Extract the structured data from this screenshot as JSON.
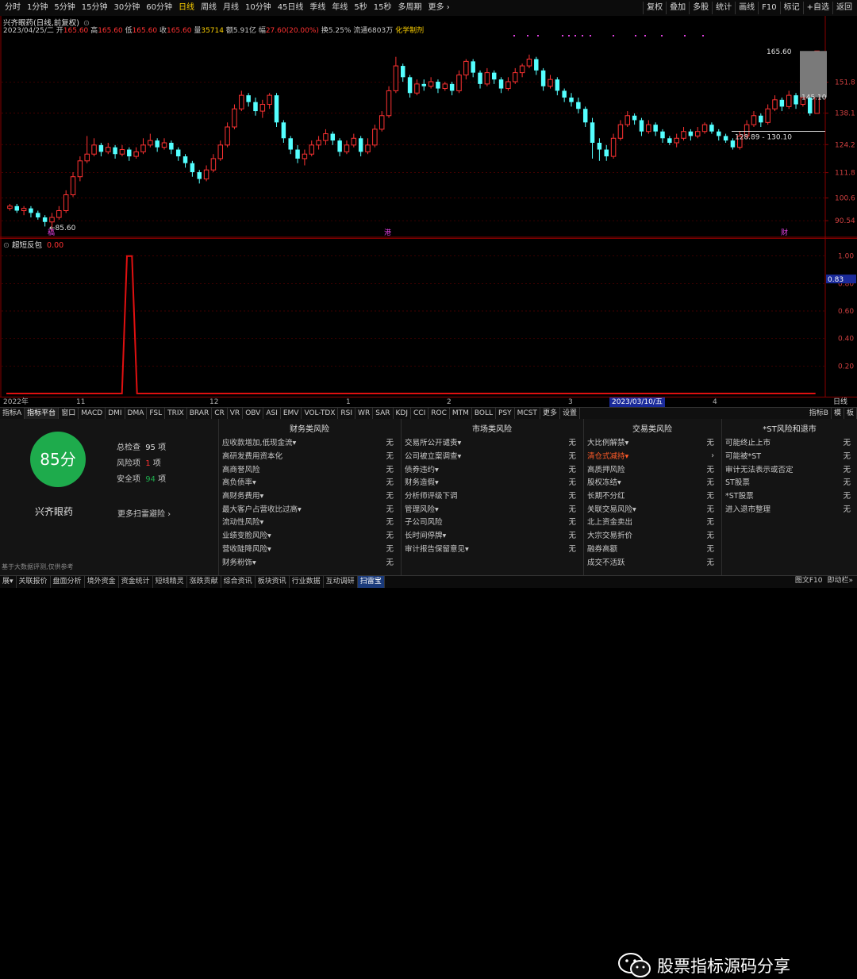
{
  "topbar": {
    "periods": [
      "分时",
      "1分钟",
      "5分钟",
      "15分钟",
      "30分钟",
      "60分钟",
      "日线",
      "周线",
      "月线",
      "10分钟",
      "45日线",
      "季线",
      "年线",
      "5秒",
      "15秒",
      "多周期",
      "更多 ›"
    ],
    "active_period": "日线",
    "right_buttons": [
      "复权",
      "叠加",
      "多股",
      "统计",
      "画线",
      "F10",
      "标记",
      "+自选",
      "返回"
    ]
  },
  "header": {
    "title": "兴齐眼药(日线,前复权)",
    "date": "2023/04/25/二",
    "open_label": "开",
    "open": "165.60",
    "high_label": "高",
    "high": "165.60",
    "low_label": "低",
    "low": "165.60",
    "close_label": "收",
    "close": "165.60",
    "vol_label": "量",
    "vol": "35714",
    "amt_label": "额",
    "amt": "5.91亿",
    "chg_label": "幅",
    "chg": "27.60(20.00%)",
    "turn_label": "换",
    "turn": "5.25%",
    "float_label": "流通",
    "float": "6803万",
    "sector": "化学制剂"
  },
  "price_axis": {
    "ticks": [
      "151.8",
      "138.1",
      "124.2",
      "111.8",
      "100.6",
      "90.54"
    ],
    "annotations": {
      "high_mark": "165.60",
      "low_mark": "85.60",
      "right_mark": "145.10",
      "range_box": "128.89 - 130.10"
    },
    "markers": [
      "稿",
      "港",
      "财"
    ]
  },
  "sub_indicator": {
    "name": "超短反包",
    "value": "0.00",
    "ticks": [
      "1.00",
      "0.80",
      "0.60",
      "0.40",
      "0.20"
    ],
    "current_tag": "0.83"
  },
  "date_axis": {
    "labels": [
      "2022年",
      "11",
      "12",
      "1",
      "2",
      "3",
      "4"
    ],
    "highlight": "2023/03/10/五",
    "right_label": "日线"
  },
  "indicator_tabs": [
    "指标A",
    "指标平台",
    "窗口",
    "MACD",
    "DMI",
    "DMA",
    "FSL",
    "TRIX",
    "BRAR",
    "CR",
    "VR",
    "OBV",
    "ASI",
    "EMV",
    "VOL-TDX",
    "RSI",
    "WR",
    "SAR",
    "KDJ",
    "CCI",
    "ROC",
    "MTM",
    "BOLL",
    "PSY",
    "MCST",
    "更多",
    "设置"
  ],
  "indicator_tabs_right": [
    "指标B",
    "模",
    "板"
  ],
  "risk": {
    "score": "85分",
    "stock_name": "兴齐眼药",
    "total_label": "总检查",
    "total": "95",
    "total_unit": "项",
    "risk_label": "风险项",
    "risk_count": "1",
    "risk_unit": "项",
    "safe_label": "安全项",
    "safe_count": "94",
    "safe_unit": "项",
    "more_scan": "更多扫雷避险 ›",
    "disclaimer": "基于大数据评测,仅供参考",
    "columns": [
      {
        "title": "财务类风险",
        "items": [
          {
            "label": "应收款增加,低现金流▾",
            "value": "无"
          },
          {
            "label": "高研发费用资本化",
            "value": "无"
          },
          {
            "label": "高商誉风险",
            "value": "无"
          },
          {
            "label": "高负债率▾",
            "value": "无"
          },
          {
            "label": "高财务费用▾",
            "value": "无"
          },
          {
            "label": "最大客户占营收比过高▾",
            "value": "无"
          },
          {
            "label": "流动性风险▾",
            "value": "无"
          },
          {
            "label": "业绩变脸风险▾",
            "value": "无"
          },
          {
            "label": "营收陡降风险▾",
            "value": "无"
          },
          {
            "label": "财务粉饰▾",
            "value": "无"
          }
        ]
      },
      {
        "title": "市场类风险",
        "items": [
          {
            "label": "交易所公开谴责▾",
            "value": "无"
          },
          {
            "label": "公司被立案调查▾",
            "value": "无"
          },
          {
            "label": "债券违约▾",
            "value": "无"
          },
          {
            "label": "财务造假▾",
            "value": "无"
          },
          {
            "label": "分析师评级下调",
            "value": "无"
          },
          {
            "label": "管理风险▾",
            "value": "无"
          },
          {
            "label": "子公司风险",
            "value": "无"
          },
          {
            "label": "长时间停牌▾",
            "value": "无"
          },
          {
            "label": "审计报告保留意见▾",
            "value": "无"
          }
        ]
      },
      {
        "title": "交易类风险",
        "items": [
          {
            "label": "大比例解禁▾",
            "value": "无"
          },
          {
            "label": "清仓式减持▾",
            "value": "›",
            "alert": true
          },
          {
            "label": "高质押风险",
            "value": "无"
          },
          {
            "label": "股权冻结▾",
            "value": "无"
          },
          {
            "label": "长期不分红",
            "value": "无"
          },
          {
            "label": "关联交易风险▾",
            "value": "无"
          },
          {
            "label": "北上资金卖出",
            "value": "无"
          },
          {
            "label": "大宗交易折价",
            "value": "无"
          },
          {
            "label": "融券高额",
            "value": "无"
          },
          {
            "label": "成交不活跃",
            "value": "无"
          }
        ]
      },
      {
        "title": "*ST风险和退市",
        "items": [
          {
            "label": "可能终止上市",
            "value": "无"
          },
          {
            "label": "可能被*ST",
            "value": "无"
          },
          {
            "label": "审计无法表示或否定",
            "value": "无"
          },
          {
            "label": "ST股票",
            "value": "无"
          },
          {
            "label": "*ST股票",
            "value": "无"
          },
          {
            "label": "进入退市整理",
            "value": "无"
          }
        ]
      }
    ]
  },
  "bottombar": {
    "items": [
      "展▾",
      "关联报价",
      "盘面分析",
      "境外资金",
      "资金统计",
      "短线精灵",
      "涨跌贡献",
      "综合资讯",
      "板块资讯",
      "行业数据",
      "互动调研",
      "扫雷宝"
    ],
    "active": "扫雷宝",
    "right": [
      "图文F10",
      "即动栏»"
    ]
  },
  "watermark": "股票指标源码分享",
  "colors": {
    "up": "#ff3232",
    "down": "#54ffff",
    "accent": "#ffd200",
    "grid": "#8a0000",
    "signal": "#e01010"
  },
  "chart_data": {
    "type": "candlestick",
    "title": "兴齐眼药(日线,前复权)",
    "ylim": [
      85,
      172
    ],
    "candles": [
      {
        "o": 96,
        "c": 97,
        "h": 98,
        "l": 95
      },
      {
        "o": 97,
        "c": 95,
        "h": 98,
        "l": 94
      },
      {
        "o": 95,
        "c": 96,
        "h": 97,
        "l": 93
      },
      {
        "o": 96,
        "c": 94,
        "h": 97,
        "l": 92
      },
      {
        "o": 94,
        "c": 92,
        "h": 95,
        "l": 91
      },
      {
        "o": 92,
        "c": 90,
        "h": 93,
        "l": 88
      },
      {
        "o": 90,
        "c": 92,
        "h": 94,
        "l": 86
      },
      {
        "o": 92,
        "c": 95,
        "h": 97,
        "l": 91
      },
      {
        "o": 95,
        "c": 102,
        "h": 104,
        "l": 94
      },
      {
        "o": 102,
        "c": 110,
        "h": 112,
        "l": 101
      },
      {
        "o": 110,
        "c": 117,
        "h": 119,
        "l": 108
      },
      {
        "o": 117,
        "c": 120,
        "h": 128,
        "l": 116
      },
      {
        "o": 120,
        "c": 124,
        "h": 127,
        "l": 119
      },
      {
        "o": 124,
        "c": 121,
        "h": 125,
        "l": 119
      },
      {
        "o": 121,
        "c": 123,
        "h": 125,
        "l": 120
      },
      {
        "o": 123,
        "c": 120,
        "h": 124,
        "l": 118
      },
      {
        "o": 120,
        "c": 122,
        "h": 124,
        "l": 119
      },
      {
        "o": 122,
        "c": 119,
        "h": 123,
        "l": 117
      },
      {
        "o": 119,
        "c": 121,
        "h": 123,
        "l": 118
      },
      {
        "o": 121,
        "c": 124,
        "h": 127,
        "l": 120
      },
      {
        "o": 124,
        "c": 126,
        "h": 129,
        "l": 123
      },
      {
        "o": 126,
        "c": 123,
        "h": 127,
        "l": 121
      },
      {
        "o": 123,
        "c": 125,
        "h": 127,
        "l": 122
      },
      {
        "o": 125,
        "c": 122,
        "h": 126,
        "l": 120
      },
      {
        "o": 122,
        "c": 119,
        "h": 123,
        "l": 117
      },
      {
        "o": 119,
        "c": 116,
        "h": 120,
        "l": 114
      },
      {
        "o": 116,
        "c": 112,
        "h": 117,
        "l": 110
      },
      {
        "o": 112,
        "c": 109,
        "h": 113,
        "l": 107
      },
      {
        "o": 109,
        "c": 113,
        "h": 115,
        "l": 108
      },
      {
        "o": 113,
        "c": 118,
        "h": 120,
        "l": 112
      },
      {
        "o": 118,
        "c": 124,
        "h": 126,
        "l": 117
      },
      {
        "o": 124,
        "c": 132,
        "h": 134,
        "l": 123
      },
      {
        "o": 132,
        "c": 140,
        "h": 142,
        "l": 131
      },
      {
        "o": 140,
        "c": 146,
        "h": 148,
        "l": 139
      },
      {
        "o": 146,
        "c": 143,
        "h": 147,
        "l": 141
      },
      {
        "o": 143,
        "c": 139,
        "h": 145,
        "l": 137
      },
      {
        "o": 139,
        "c": 142,
        "h": 144,
        "l": 136
      },
      {
        "o": 142,
        "c": 146,
        "h": 147,
        "l": 140
      },
      {
        "o": 146,
        "c": 134,
        "h": 147,
        "l": 132
      },
      {
        "o": 134,
        "c": 127,
        "h": 135,
        "l": 125
      },
      {
        "o": 127,
        "c": 122,
        "h": 128,
        "l": 120
      },
      {
        "o": 122,
        "c": 118,
        "h": 124,
        "l": 116
      },
      {
        "o": 118,
        "c": 120,
        "h": 122,
        "l": 115
      },
      {
        "o": 120,
        "c": 124,
        "h": 126,
        "l": 119
      },
      {
        "o": 124,
        "c": 126,
        "h": 128,
        "l": 122
      },
      {
        "o": 126,
        "c": 129,
        "h": 131,
        "l": 124
      },
      {
        "o": 129,
        "c": 126,
        "h": 130,
        "l": 124
      },
      {
        "o": 126,
        "c": 121,
        "h": 127,
        "l": 119
      },
      {
        "o": 121,
        "c": 124,
        "h": 126,
        "l": 120
      },
      {
        "o": 124,
        "c": 127,
        "h": 129,
        "l": 123
      },
      {
        "o": 127,
        "c": 121,
        "h": 128,
        "l": 119
      },
      {
        "o": 121,
        "c": 124,
        "h": 127,
        "l": 120
      },
      {
        "o": 124,
        "c": 131,
        "h": 133,
        "l": 123
      },
      {
        "o": 131,
        "c": 137,
        "h": 139,
        "l": 130
      },
      {
        "o": 137,
        "c": 148,
        "h": 150,
        "l": 136
      },
      {
        "o": 148,
        "c": 159,
        "h": 163,
        "l": 147
      },
      {
        "o": 159,
        "c": 154,
        "h": 160,
        "l": 152
      },
      {
        "o": 154,
        "c": 147,
        "h": 155,
        "l": 145
      },
      {
        "o": 147,
        "c": 151,
        "h": 153,
        "l": 146
      },
      {
        "o": 151,
        "c": 150,
        "h": 153,
        "l": 148
      },
      {
        "o": 150,
        "c": 152,
        "h": 154,
        "l": 149
      },
      {
        "o": 152,
        "c": 149,
        "h": 153,
        "l": 147
      },
      {
        "o": 149,
        "c": 151,
        "h": 152,
        "l": 148
      },
      {
        "o": 151,
        "c": 148,
        "h": 152,
        "l": 146
      },
      {
        "o": 148,
        "c": 155,
        "h": 157,
        "l": 147
      },
      {
        "o": 155,
        "c": 161,
        "h": 162,
        "l": 153
      },
      {
        "o": 161,
        "c": 156,
        "h": 162,
        "l": 154
      },
      {
        "o": 156,
        "c": 151,
        "h": 157,
        "l": 149
      },
      {
        "o": 151,
        "c": 156,
        "h": 158,
        "l": 150
      },
      {
        "o": 156,
        "c": 153,
        "h": 157,
        "l": 151
      },
      {
        "o": 153,
        "c": 149,
        "h": 154,
        "l": 147
      },
      {
        "o": 149,
        "c": 152,
        "h": 154,
        "l": 148
      },
      {
        "o": 152,
        "c": 156,
        "h": 158,
        "l": 151
      },
      {
        "o": 156,
        "c": 159,
        "h": 160,
        "l": 154
      },
      {
        "o": 159,
        "c": 162,
        "h": 164,
        "l": 158
      },
      {
        "o": 162,
        "c": 157,
        "h": 163,
        "l": 155
      },
      {
        "o": 157,
        "c": 150,
        "h": 158,
        "l": 148
      },
      {
        "o": 150,
        "c": 153,
        "h": 155,
        "l": 149
      },
      {
        "o": 153,
        "c": 148,
        "h": 154,
        "l": 146
      },
      {
        "o": 148,
        "c": 145,
        "h": 149,
        "l": 143
      },
      {
        "o": 145,
        "c": 143,
        "h": 147,
        "l": 141
      },
      {
        "o": 143,
        "c": 140,
        "h": 145,
        "l": 138
      },
      {
        "o": 140,
        "c": 134,
        "h": 141,
        "l": 132
      },
      {
        "o": 134,
        "c": 125,
        "h": 136,
        "l": 118
      },
      {
        "o": 125,
        "c": 122,
        "h": 127,
        "l": 117
      },
      {
        "o": 122,
        "c": 119,
        "h": 124,
        "l": 117
      },
      {
        "o": 119,
        "c": 127,
        "h": 129,
        "l": 118
      },
      {
        "o": 127,
        "c": 133,
        "h": 135,
        "l": 126
      },
      {
        "o": 133,
        "c": 137,
        "h": 139,
        "l": 132
      },
      {
        "o": 137,
        "c": 135,
        "h": 138,
        "l": 133
      },
      {
        "o": 135,
        "c": 130,
        "h": 136,
        "l": 128
      },
      {
        "o": 130,
        "c": 133,
        "h": 135,
        "l": 129
      },
      {
        "o": 133,
        "c": 130,
        "h": 134,
        "l": 128
      },
      {
        "o": 130,
        "c": 127,
        "h": 131,
        "l": 125
      },
      {
        "o": 127,
        "c": 125,
        "h": 128,
        "l": 124
      },
      {
        "o": 125,
        "c": 127,
        "h": 129,
        "l": 123
      },
      {
        "o": 127,
        "c": 130,
        "h": 132,
        "l": 126
      },
      {
        "o": 130,
        "c": 128,
        "h": 131,
        "l": 126
      },
      {
        "o": 128,
        "c": 130,
        "h": 132,
        "l": 127
      },
      {
        "o": 130,
        "c": 133,
        "h": 134,
        "l": 129
      },
      {
        "o": 133,
        "c": 130,
        "h": 134,
        "l": 129
      },
      {
        "o": 130,
        "c": 128,
        "h": 131,
        "l": 126
      },
      {
        "o": 128,
        "c": 126,
        "h": 129,
        "l": 125
      },
      {
        "o": 126,
        "c": 123,
        "h": 127,
        "l": 122
      },
      {
        "o": 123,
        "c": 128,
        "h": 130,
        "l": 122
      },
      {
        "o": 128,
        "c": 133,
        "h": 135,
        "l": 127
      },
      {
        "o": 133,
        "c": 137,
        "h": 139,
        "l": 132
      },
      {
        "o": 137,
        "c": 134,
        "h": 138,
        "l": 132
      },
      {
        "o": 134,
        "c": 140,
        "h": 142,
        "l": 133
      },
      {
        "o": 140,
        "c": 144,
        "h": 146,
        "l": 139
      },
      {
        "o": 144,
        "c": 141,
        "h": 145,
        "l": 139
      },
      {
        "o": 141,
        "c": 146,
        "h": 148,
        "l": 140
      },
      {
        "o": 146,
        "c": 142,
        "h": 147,
        "l": 140
      },
      {
        "o": 142,
        "c": 145,
        "h": 147,
        "l": 141
      },
      {
        "o": 145,
        "c": 138,
        "h": 146,
        "l": 137
      },
      {
        "o": 138,
        "c": 165.6,
        "h": 165.6,
        "l": 138
      }
    ],
    "signal": {
      "name": "超短反包",
      "ylim": [
        0,
        1.05
      ],
      "values": [
        0,
        0,
        0,
        0,
        0,
        0,
        0,
        0,
        0,
        0,
        0,
        0,
        0,
        0,
        0,
        0,
        0,
        0,
        0,
        0,
        0,
        0,
        0,
        0,
        1,
        1,
        0,
        0,
        0,
        0,
        0,
        0,
        0,
        0,
        0,
        0,
        0,
        0,
        0,
        0,
        0,
        0,
        0,
        0,
        0,
        0,
        0,
        0,
        0,
        0,
        0,
        0,
        0,
        0,
        0,
        0,
        0,
        0,
        0,
        0,
        0,
        0,
        0,
        0,
        0,
        0,
        0,
        0,
        0,
        0,
        0,
        0,
        0,
        0,
        0,
        0,
        0,
        0,
        0,
        0,
        0,
        0,
        0,
        0,
        0,
        0,
        0,
        0,
        0,
        0,
        0,
        0,
        0,
        0,
        0,
        0,
        0,
        0,
        0,
        0,
        0,
        0,
        0,
        0,
        0,
        0,
        0,
        0,
        0,
        0,
        0,
        0,
        0,
        0,
        0,
        0,
        0,
        0,
        0,
        0,
        0,
        0,
        0,
        0,
        0,
        0,
        0,
        0,
        0,
        0,
        0,
        0,
        0,
        0,
        0,
        0,
        0,
        0,
        0,
        0,
        0,
        0,
        0,
        0,
        0,
        0,
        0,
        0,
        0,
        0,
        0,
        0,
        0,
        0,
        0,
        0,
        0,
        0,
        0,
        0,
        0,
        0
      ]
    }
  }
}
